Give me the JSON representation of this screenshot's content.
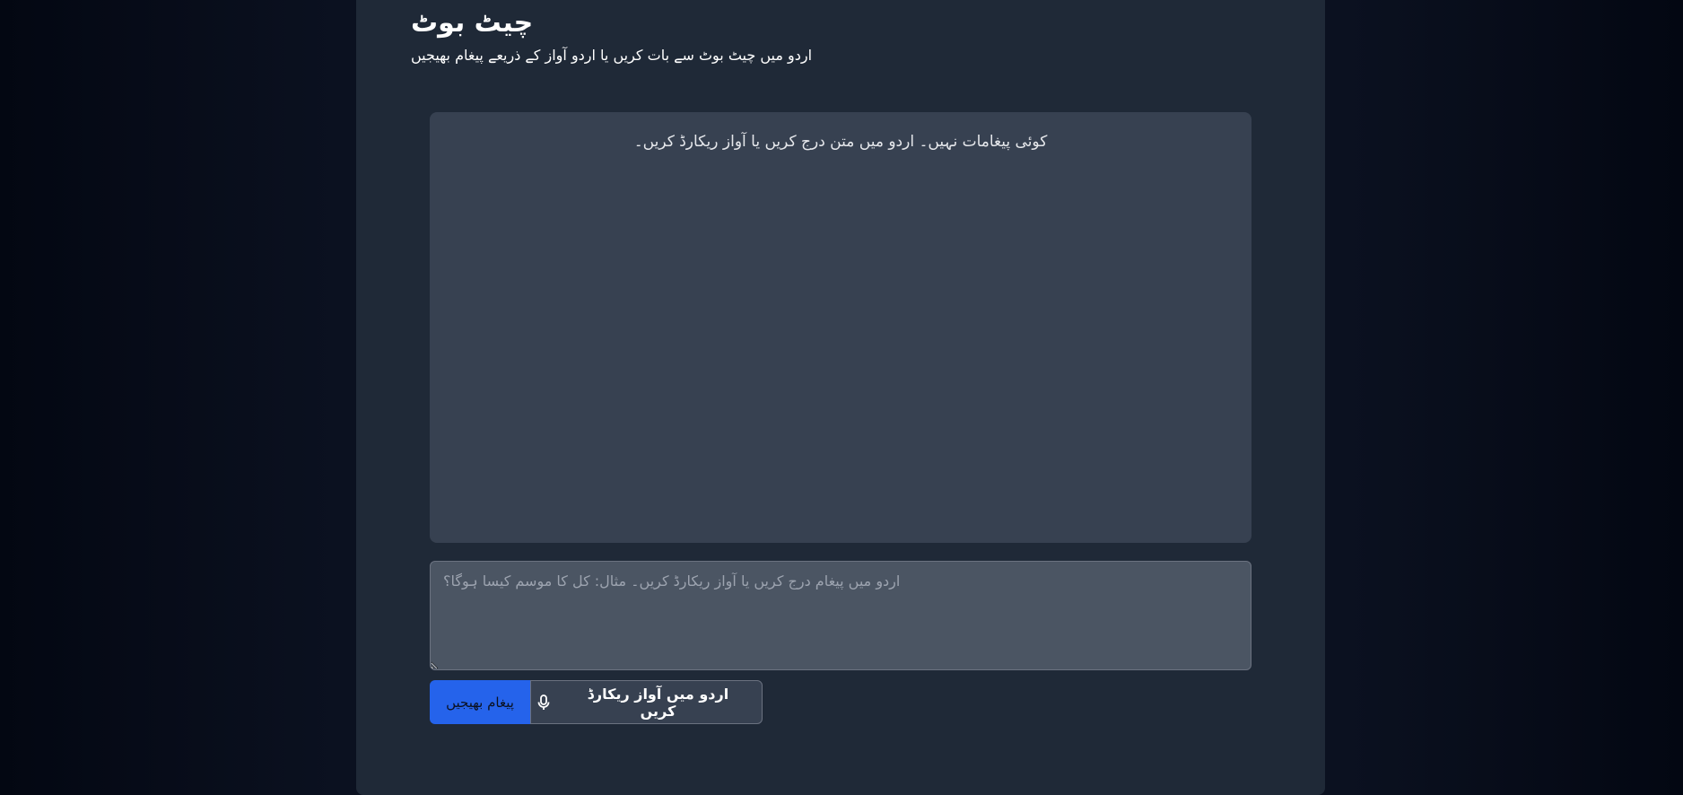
{
  "header": {
    "title": "چیٹ بوٹ",
    "subtitle": "اردو میں چیٹ بوٹ سے بات کریں یا اردو آواز کے ذریعے پیغام بھیجیں"
  },
  "messages": {
    "empty_text": "کوئی پیغامات نہیں۔ اردو میں متن درج کریں یا آواز ریکارڈ کریں۔"
  },
  "composer": {
    "value": "",
    "placeholder": "اردو میں پیغام درج کریں یا آواز ریکارڈ کریں۔ مثال: کل کا موسم کیسا ہوگا؟",
    "send_label": "پیغام بھیجیں",
    "record_label": "اردو میں آواز ریکارڈ کریں",
    "record_icon": "microphone-icon"
  },
  "colors": {
    "page_background": "#020617",
    "panel_background": "#1f2937",
    "messages_background": "#374151",
    "input_background": "#4b5563",
    "send_button": "#2563eb"
  }
}
